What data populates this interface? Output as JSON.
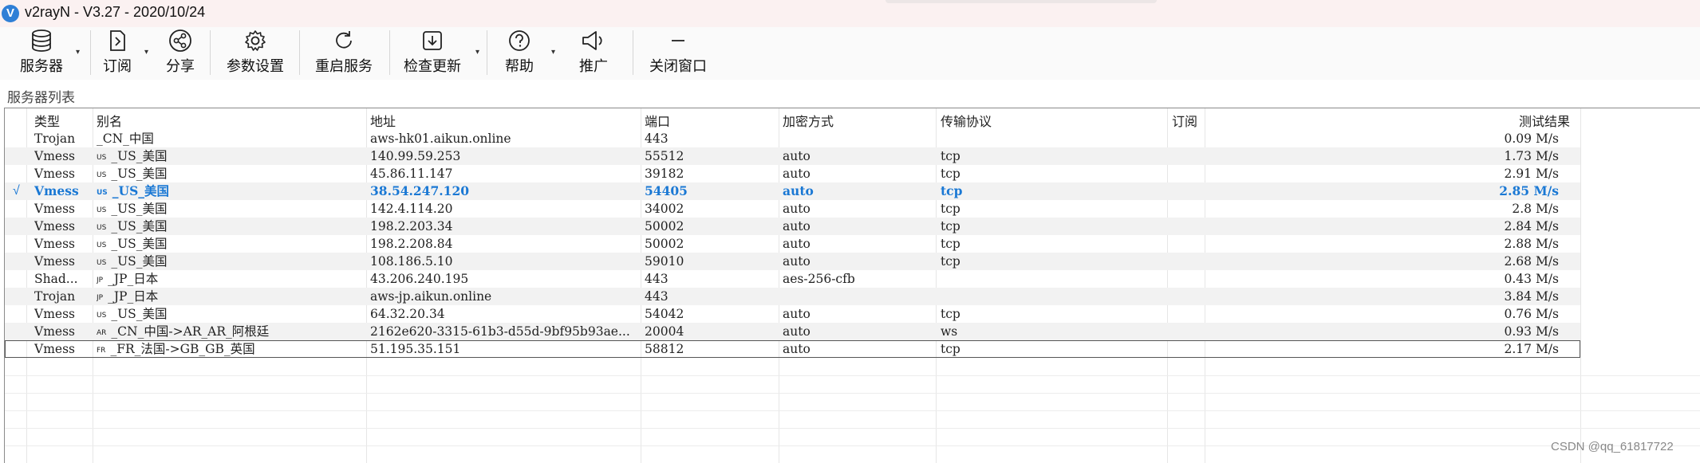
{
  "window": {
    "title": "v2rayN - V3.27 - 2020/10/24",
    "app_icon": "V"
  },
  "toolbar": {
    "servers": "服务器",
    "subscribe": "订阅",
    "share": "分享",
    "settings": "参数设置",
    "restart": "重启服务",
    "check_update": "检查更新",
    "help": "帮助",
    "promote": "推广",
    "close_window": "关闭窗口"
  },
  "group_label": "服务器列表",
  "table": {
    "headers": {
      "type": "类型",
      "alias": "别名",
      "address": "地址",
      "port": "端口",
      "encryption": "加密方式",
      "transport": "传输协议",
      "subscription": "订阅",
      "test_result": "测试结果"
    },
    "selected_mark": "√",
    "rows": [
      {
        "type": "Trojan",
        "flag": "",
        "alias": "_CN_中国",
        "address": "aws-hk01.aikun.online",
        "port": "443",
        "encryption": "",
        "transport": "",
        "subscription": "",
        "test_result": "0.09 M/s"
      },
      {
        "type": "Vmess",
        "flag": "US",
        "alias": "_US_美国",
        "address": "140.99.59.253",
        "port": "55512",
        "encryption": "auto",
        "transport": "tcp",
        "subscription": "",
        "test_result": "1.73 M/s"
      },
      {
        "type": "Vmess",
        "flag": "US",
        "alias": "_US_美国",
        "address": "45.86.11.147",
        "port": "39182",
        "encryption": "auto",
        "transport": "tcp",
        "subscription": "",
        "test_result": "2.91 M/s"
      },
      {
        "type": "Vmess",
        "flag": "US",
        "alias": "_US_美国",
        "address": "38.54.247.120",
        "port": "54405",
        "encryption": "auto",
        "transport": "tcp",
        "subscription": "",
        "test_result": "2.85 M/s"
      },
      {
        "type": "Vmess",
        "flag": "US",
        "alias": "_US_美国",
        "address": "142.4.114.20",
        "port": "34002",
        "encryption": "auto",
        "transport": "tcp",
        "subscription": "",
        "test_result": "2.8 M/s"
      },
      {
        "type": "Vmess",
        "flag": "US",
        "alias": "_US_美国",
        "address": "198.2.203.34",
        "port": "50002",
        "encryption": "auto",
        "transport": "tcp",
        "subscription": "",
        "test_result": "2.84 M/s"
      },
      {
        "type": "Vmess",
        "flag": "US",
        "alias": "_US_美国",
        "address": "198.2.208.84",
        "port": "50002",
        "encryption": "auto",
        "transport": "tcp",
        "subscription": "",
        "test_result": "2.88 M/s"
      },
      {
        "type": "Vmess",
        "flag": "US",
        "alias": "_US_美国",
        "address": "108.186.5.10",
        "port": "59010",
        "encryption": "auto",
        "transport": "tcp",
        "subscription": "",
        "test_result": "2.68 M/s"
      },
      {
        "type": "Shad...",
        "flag": "JP",
        "alias": "_JP_日本",
        "address": "43.206.240.195",
        "port": "443",
        "encryption": "aes-256-cfb",
        "transport": "",
        "subscription": "",
        "test_result": "0.43 M/s"
      },
      {
        "type": "Trojan",
        "flag": "JP",
        "alias": "_JP_日本",
        "address": "aws-jp.aikun.online",
        "port": "443",
        "encryption": "",
        "transport": "",
        "subscription": "",
        "test_result": "3.84 M/s"
      },
      {
        "type": "Vmess",
        "flag": "US",
        "alias": "_US_美国",
        "address": "64.32.20.34",
        "port": "54042",
        "encryption": "auto",
        "transport": "tcp",
        "subscription": "",
        "test_result": "0.76 M/s"
      },
      {
        "type": "Vmess",
        "flag": "AR",
        "alias": "_CN_中国->AR_AR_阿根廷",
        "address": "2162e620-3315-61b3-d55d-9bf95b93ae...",
        "port": "20004",
        "encryption": "auto",
        "transport": "ws",
        "subscription": "",
        "test_result": "0.93 M/s"
      },
      {
        "type": "Vmess",
        "flag": "FR",
        "alias": "_FR_法国->GB_GB_英国",
        "address": "51.195.35.151",
        "port": "58812",
        "encryption": "auto",
        "transport": "tcp",
        "subscription": "",
        "test_result": "2.17 M/s"
      }
    ]
  },
  "watermark": "CSDN @qq_61817722",
  "colors": {
    "selected_row_text": "#1a78d4",
    "app_icon": "#2f7fd6",
    "alt_row": "#f2f2f2"
  }
}
